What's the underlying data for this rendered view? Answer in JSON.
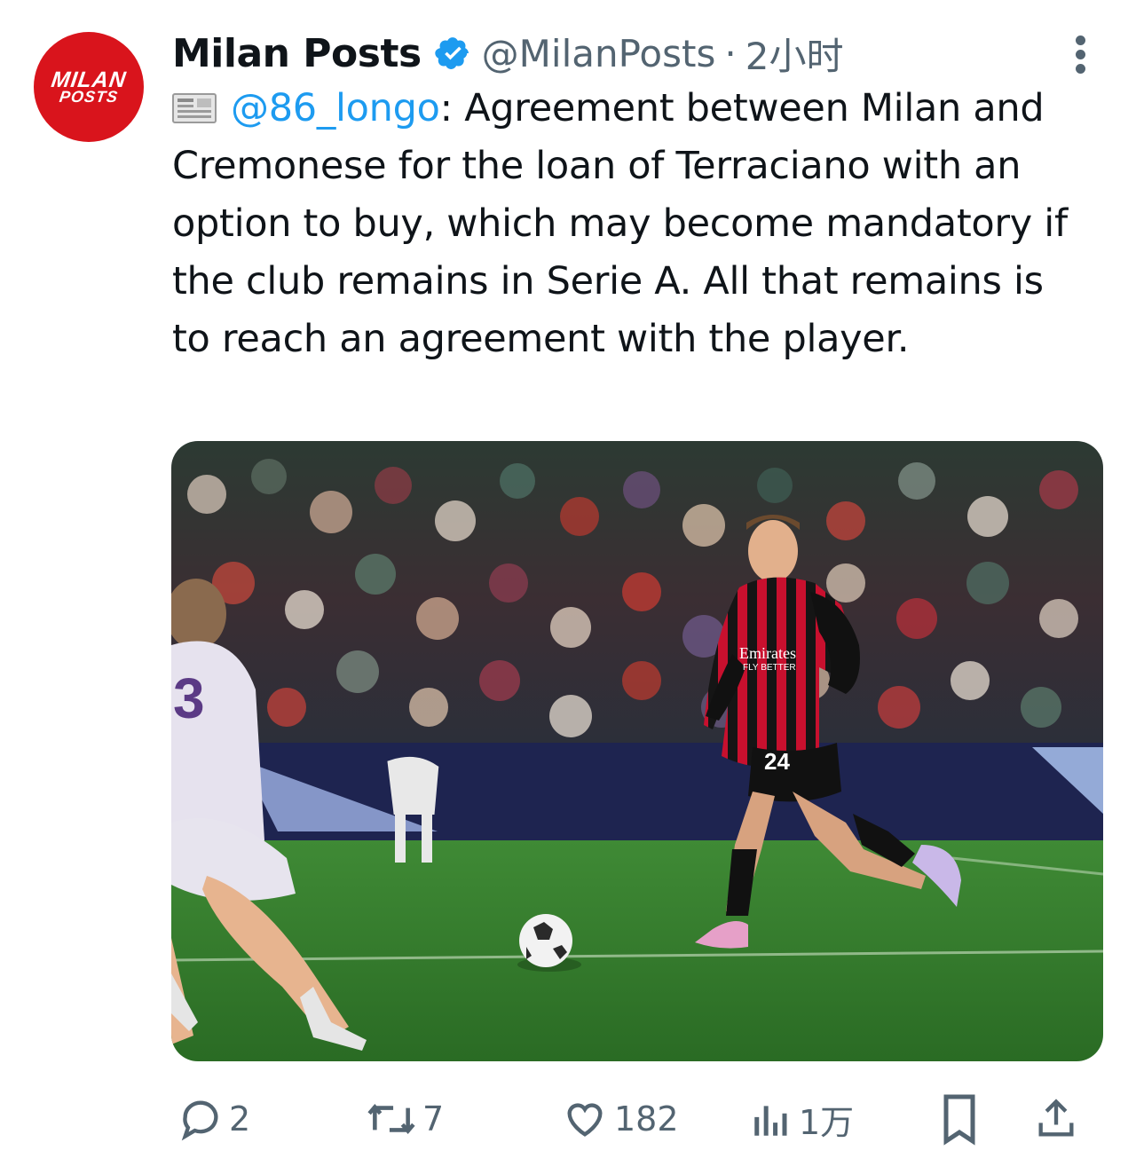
{
  "post": {
    "avatar_text_line1": "MILAN",
    "avatar_text_line2": "POSTS",
    "display_name": "Milan Posts",
    "handle": "@MilanPosts",
    "separator": "·",
    "timestamp": "2小时",
    "mention": "@86_longo",
    "text_after_mention": ": Agreement between Milan and Cremonese for the loan of Terraciano with an option to buy, which may become mandatory if the club remains in Serie A. All that remains is to reach an agreement with the player.",
    "media_jersey_sponsor_line1": "Emirates",
    "media_jersey_sponsor_line2": "FLY BETTER",
    "media_player_number": "24",
    "media_opponent_number": "3"
  },
  "actions": {
    "reply_count": "2",
    "repost_count": "7",
    "like_count": "182",
    "views_count": "1万"
  },
  "icons": {
    "verified": "verified-badge-icon",
    "more": "more-options-icon",
    "newspaper": "newspaper-emoji-icon",
    "reply": "reply-icon",
    "repost": "repost-icon",
    "like": "like-icon",
    "views": "views-icon",
    "bookmark": "bookmark-icon",
    "share": "share-icon"
  },
  "colors": {
    "avatar_bg": "#d9141c",
    "verified": "#1d9bf0",
    "mention": "#1d9bf0",
    "muted": "#536471",
    "text": "#0f1419"
  }
}
